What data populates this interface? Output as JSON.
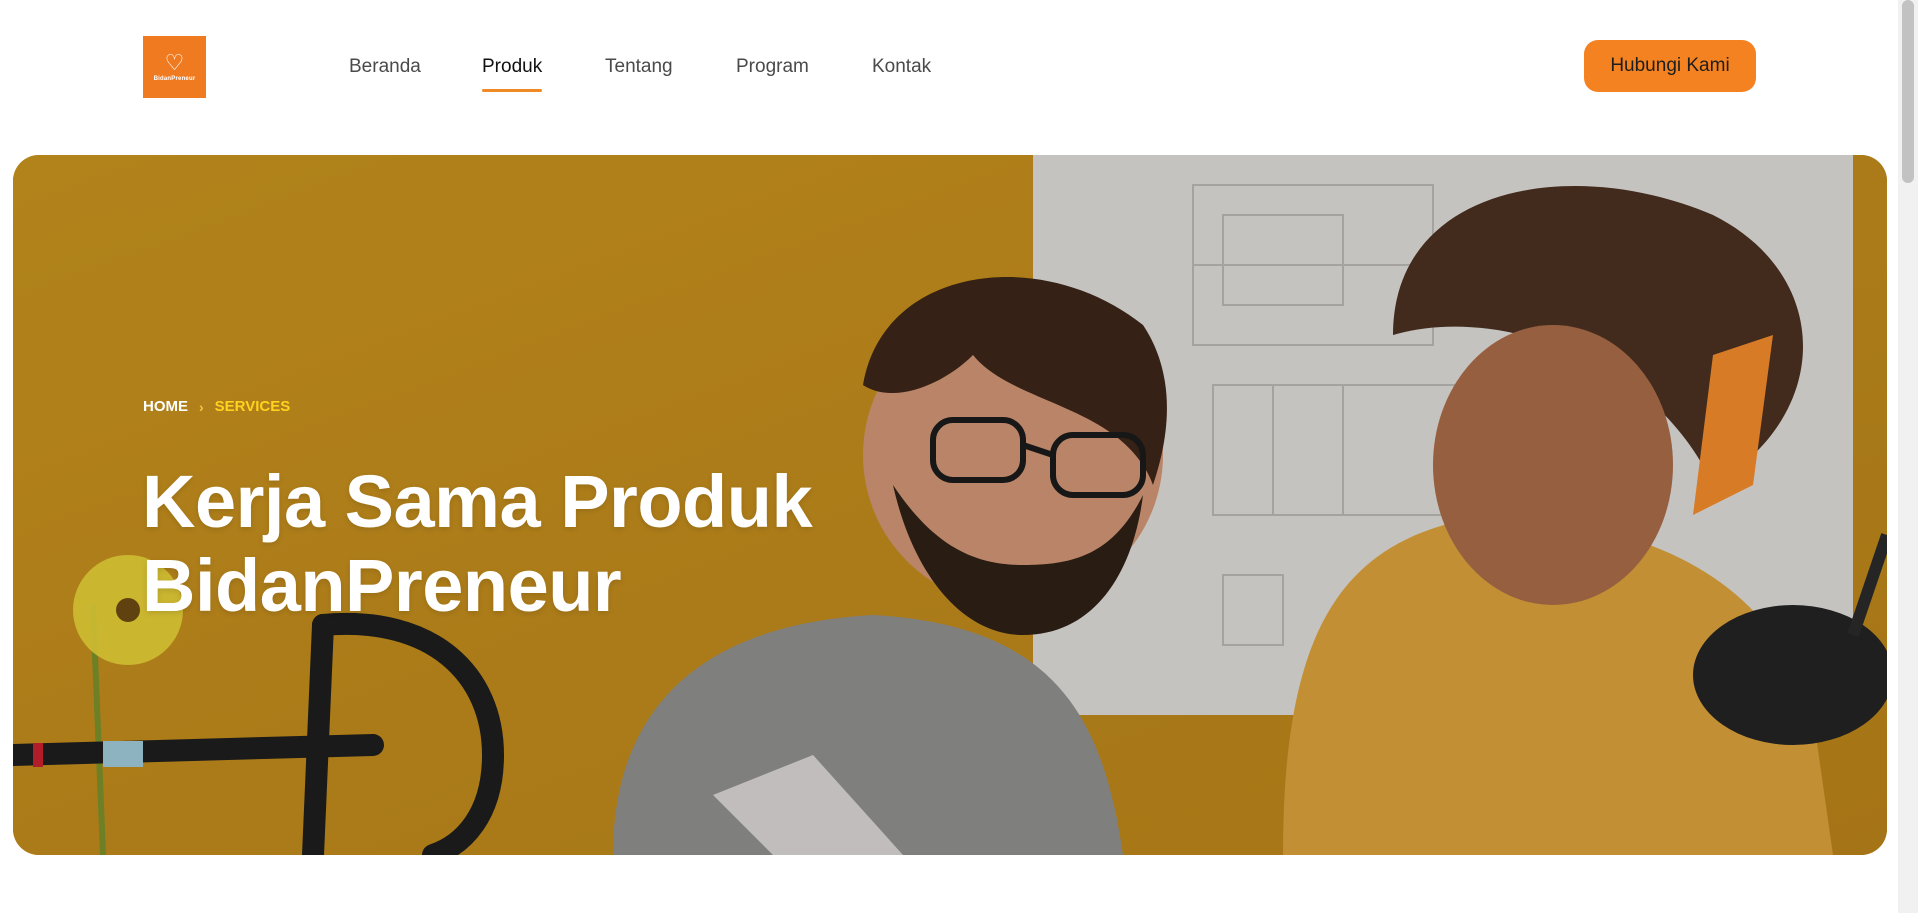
{
  "logo": {
    "text": "BidanPreneur",
    "subtext": "",
    "icon": "heart-hand-logo"
  },
  "nav": {
    "items": [
      {
        "label": "Beranda",
        "active": false
      },
      {
        "label": "Produk",
        "active": true
      },
      {
        "label": "Tentang",
        "active": false
      },
      {
        "label": "Program",
        "active": false
      },
      {
        "label": "Kontak",
        "active": false
      }
    ]
  },
  "cta": {
    "label": "Hubungi Kami"
  },
  "hero": {
    "breadcrumb": {
      "home": "HOME",
      "separator_icon": "chevron-right-icon",
      "current": "SERVICES"
    },
    "title_line1": "Kerja Sama Produk",
    "title_line2": "BidanPreneur"
  },
  "colors": {
    "accent": "#f58220",
    "brand_logo": "#f07a1f",
    "breadcrumb_active": "#ffd21f",
    "hero_bg": "#c3901f",
    "text_dark": "#1e1e1e"
  }
}
